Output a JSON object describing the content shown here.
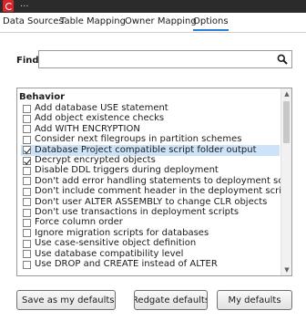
{
  "window": {
    "title": "...",
    "tabs": [
      {
        "label": "Data Sources"
      },
      {
        "label": "Table Mapping"
      },
      {
        "label": "Owner Mapping"
      },
      {
        "label": "Options",
        "active": true
      }
    ]
  },
  "find": {
    "label": "Find:",
    "value": "",
    "placeholder": "",
    "icon": "search-icon"
  },
  "options": {
    "group": "Behavior",
    "items": [
      {
        "label": "Add database USE statement",
        "checked": false,
        "selected": false
      },
      {
        "label": "Add object existence checks",
        "checked": false,
        "selected": false
      },
      {
        "label": "Add WITH ENCRYPTION",
        "checked": false,
        "selected": false
      },
      {
        "label": "Consider next filegroups in partition schemes",
        "checked": false,
        "selected": false
      },
      {
        "label": "Database Project compatible script folder output",
        "checked": true,
        "selected": true
      },
      {
        "label": "Decrypt encrypted objects",
        "checked": true,
        "selected": false
      },
      {
        "label": "Disable DDL triggers during deployment",
        "checked": false,
        "selected": false
      },
      {
        "label": "Don't add error handling statements to deployment scripts",
        "checked": false,
        "selected": false
      },
      {
        "label": "Don't include comment header in the deployment script",
        "checked": false,
        "selected": false
      },
      {
        "label": "Don't user ALTER ASSEMBLY to change CLR objects",
        "checked": false,
        "selected": false
      },
      {
        "label": "Don't use transactions in deployment scripts",
        "checked": false,
        "selected": false
      },
      {
        "label": "Force column order",
        "checked": false,
        "selected": false
      },
      {
        "label": "Ignore migration scripts for databases",
        "checked": false,
        "selected": false
      },
      {
        "label": "Use case-sensitive object definition",
        "checked": false,
        "selected": false
      },
      {
        "label": "Use database compatibility level",
        "checked": false,
        "selected": false
      },
      {
        "label": "Use DROP and CREATE instead of ALTER",
        "checked": false,
        "selected": false
      }
    ]
  },
  "buttons": {
    "save_label": "Save as my defaults",
    "redgate_label": "Redgate defaults",
    "mydefaults_label": "My defaults"
  },
  "colors": {
    "accent": "#2d7fd6",
    "selection": "#cde3f8",
    "brand": "#d8252c"
  }
}
